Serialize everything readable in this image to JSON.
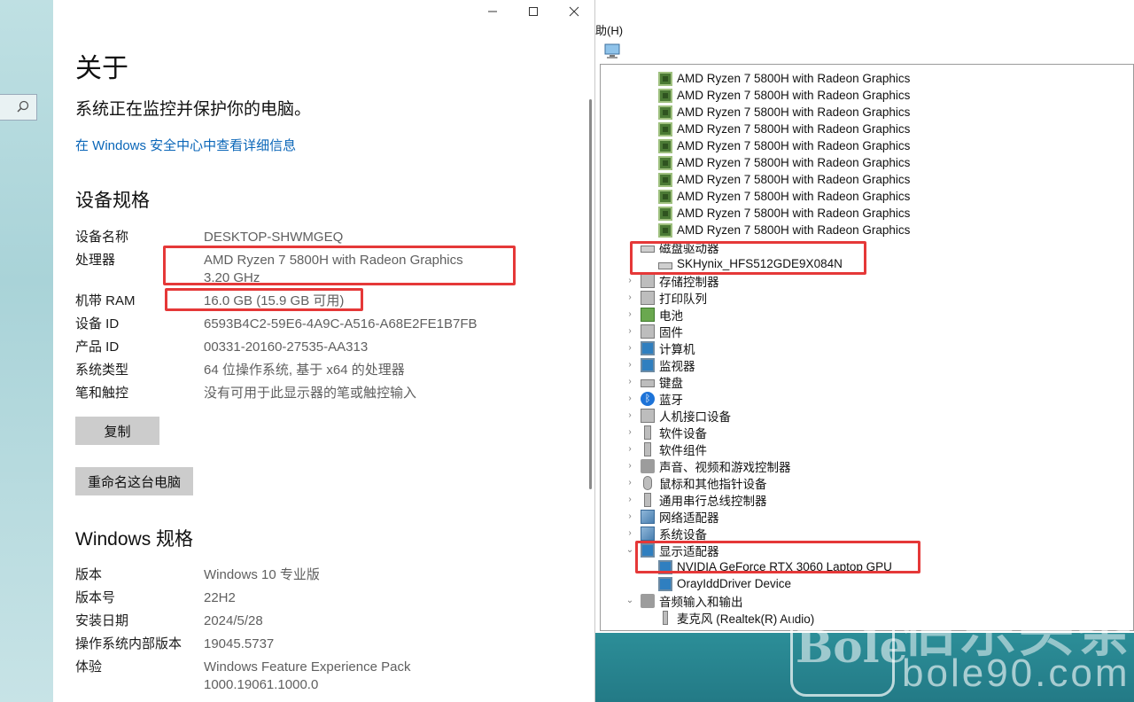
{
  "about": {
    "title": "关于",
    "protect_msg": "系统正在监控并保护你的电脑。",
    "security_link": "在 Windows 安全中心中查看详细信息",
    "device_specs_heading": "设备规格",
    "device_specs": [
      {
        "label": "设备名称",
        "value": "DESKTOP-SHWMGEQ"
      },
      {
        "label": "处理器",
        "value": "AMD Ryzen 7 5800H with Radeon Graphics",
        "value2": "3.20 GHz"
      },
      {
        "label": "机带 RAM",
        "value": "16.0 GB (15.9 GB 可用)"
      },
      {
        "label": "设备 ID",
        "value": "6593B4C2-59E6-4A9C-A516-A68E2FE1B7FB"
      },
      {
        "label": "产品 ID",
        "value": "00331-20160-27535-AA313"
      },
      {
        "label": "系统类型",
        "value": "64 位操作系统, 基于 x64 的处理器"
      },
      {
        "label": "笔和触控",
        "value": "没有可用于此显示器的笔或触控输入"
      }
    ],
    "copy_button": "复制",
    "rename_button": "重命名这台电脑",
    "windows_specs_heading": "Windows 规格",
    "windows_specs": [
      {
        "label": "版本",
        "value": "Windows 10 专业版"
      },
      {
        "label": "版本号",
        "value": "22H2"
      },
      {
        "label": "安装日期",
        "value": "2024/5/28"
      },
      {
        "label": "操作系统内部版本",
        "value": "19045.5737"
      },
      {
        "label": "体验",
        "value": "Windows Feature Experience Pack",
        "value2": "1000.19061.1000.0"
      }
    ]
  },
  "device_manager": {
    "menu_help": "助(H)",
    "processors": [
      "AMD Ryzen 7 5800H with Radeon Graphics",
      "AMD Ryzen 7 5800H with Radeon Graphics",
      "AMD Ryzen 7 5800H with Radeon Graphics",
      "AMD Ryzen 7 5800H with Radeon Graphics",
      "AMD Ryzen 7 5800H with Radeon Graphics",
      "AMD Ryzen 7 5800H with Radeon Graphics",
      "AMD Ryzen 7 5800H with Radeon Graphics",
      "AMD Ryzen 7 5800H with Radeon Graphics",
      "AMD Ryzen 7 5800H with Radeon Graphics",
      "AMD Ryzen 7 5800H with Radeon Graphics"
    ],
    "disk_category": "磁盘驱动器",
    "disk_device": "SKHynix_HFS512GDE9X084N",
    "categories": [
      "存储控制器",
      "打印队列",
      "电池",
      "固件",
      "计算机",
      "监视器",
      "键盘",
      "蓝牙",
      "人机接口设备",
      "软件设备",
      "软件组件",
      "声音、视频和游戏控制器",
      "鼠标和其他指针设备",
      "通用串行总线控制器",
      "网络适配器",
      "系统设备"
    ],
    "display_category": "显示适配器",
    "display_devices": [
      "NVIDIA GeForce RTX 3060 Laptop GPU",
      "OrayIddDriver Device"
    ],
    "audio_category": "音频输入和输出",
    "audio_devices": [
      "麦克风 (Realtek(R) Audio)"
    ]
  },
  "watermark": {
    "logo": "Bole",
    "cn": "伯乐头条",
    "url": "bole90.com"
  }
}
